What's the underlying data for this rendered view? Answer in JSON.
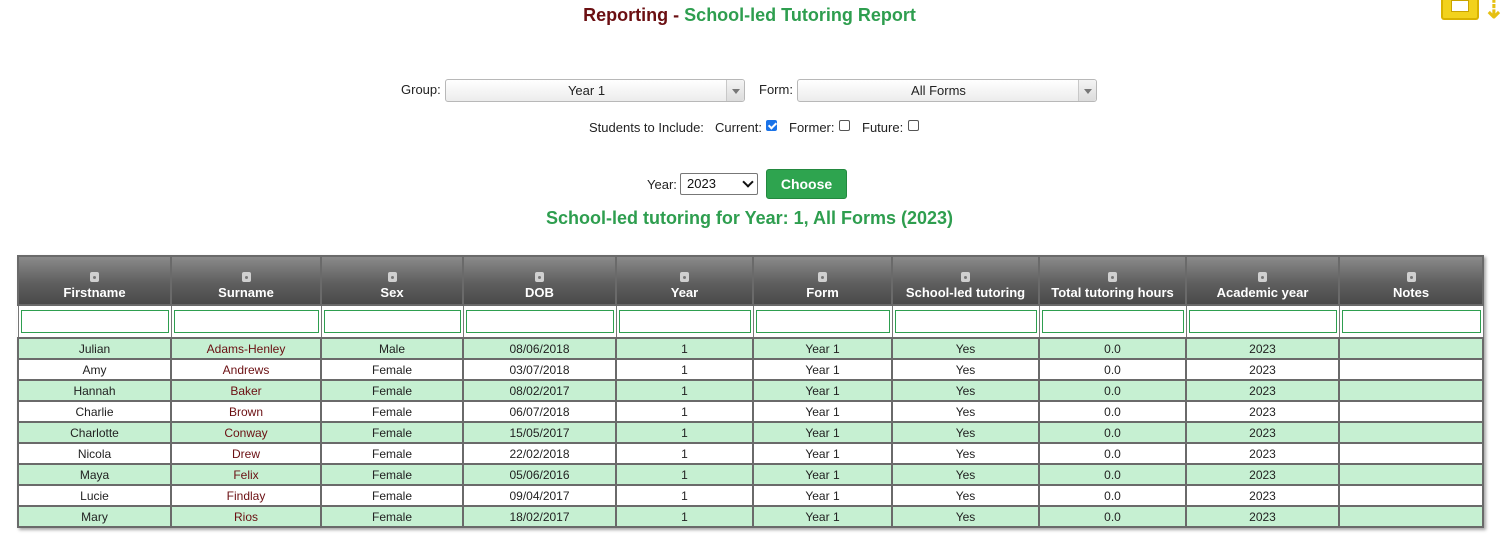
{
  "header": {
    "title_prefix": "Reporting - ",
    "title_main": "School-led Tutoring Report"
  },
  "filters": {
    "group_label": "Group:",
    "group_value": "Year 1",
    "form_label": "Form:",
    "form_value": "All Forms",
    "include_label": "Students to Include:",
    "current_label": "Current:",
    "current_checked": true,
    "former_label": "Former:",
    "former_checked": false,
    "future_label": "Future:",
    "future_checked": false,
    "year_label": "Year:",
    "year_value": "2023",
    "choose_label": "Choose"
  },
  "subtitle": "School-led tutoring for Year: 1, All Forms (2023)",
  "table": {
    "columns": [
      "Firstname",
      "Surname",
      "Sex",
      "DOB",
      "Year",
      "Form",
      "School-led tutoring",
      "Total tutoring hours",
      "Academic year",
      "Notes"
    ],
    "rows": [
      [
        "Julian",
        "Adams-Henley",
        "Male",
        "08/06/2018",
        "1",
        "Year 1",
        "Yes",
        "0.0",
        "2023",
        ""
      ],
      [
        "Amy",
        "Andrews",
        "Female",
        "03/07/2018",
        "1",
        "Year 1",
        "Yes",
        "0.0",
        "2023",
        ""
      ],
      [
        "Hannah",
        "Baker",
        "Female",
        "08/02/2017",
        "1",
        "Year 1",
        "Yes",
        "0.0",
        "2023",
        ""
      ],
      [
        "Charlie",
        "Brown",
        "Female",
        "06/07/2018",
        "1",
        "Year 1",
        "Yes",
        "0.0",
        "2023",
        ""
      ],
      [
        "Charlotte",
        "Conway",
        "Female",
        "15/05/2017",
        "1",
        "Year 1",
        "Yes",
        "0.0",
        "2023",
        ""
      ],
      [
        "Nicola",
        "Drew",
        "Female",
        "22/02/2018",
        "1",
        "Year 1",
        "Yes",
        "0.0",
        "2023",
        ""
      ],
      [
        "Maya",
        "Felix",
        "Female",
        "05/06/2016",
        "1",
        "Year 1",
        "Yes",
        "0.0",
        "2023",
        ""
      ],
      [
        "Lucie",
        "Findlay",
        "Female",
        "09/04/2017",
        "1",
        "Year 1",
        "Yes",
        "0.0",
        "2023",
        ""
      ],
      [
        "Mary",
        "Rios",
        "Female",
        "18/02/2017",
        "1",
        "Year 1",
        "Yes",
        "0.0",
        "2023",
        ""
      ]
    ]
  },
  "colors": {
    "brand_green": "#2e9e4f",
    "title_maroon": "#6b0f12",
    "row_green": "#c6f0d2"
  },
  "icons": [
    "printer-icon",
    "download-arrow-icon",
    "sort-icon",
    "chevron-down-icon"
  ]
}
